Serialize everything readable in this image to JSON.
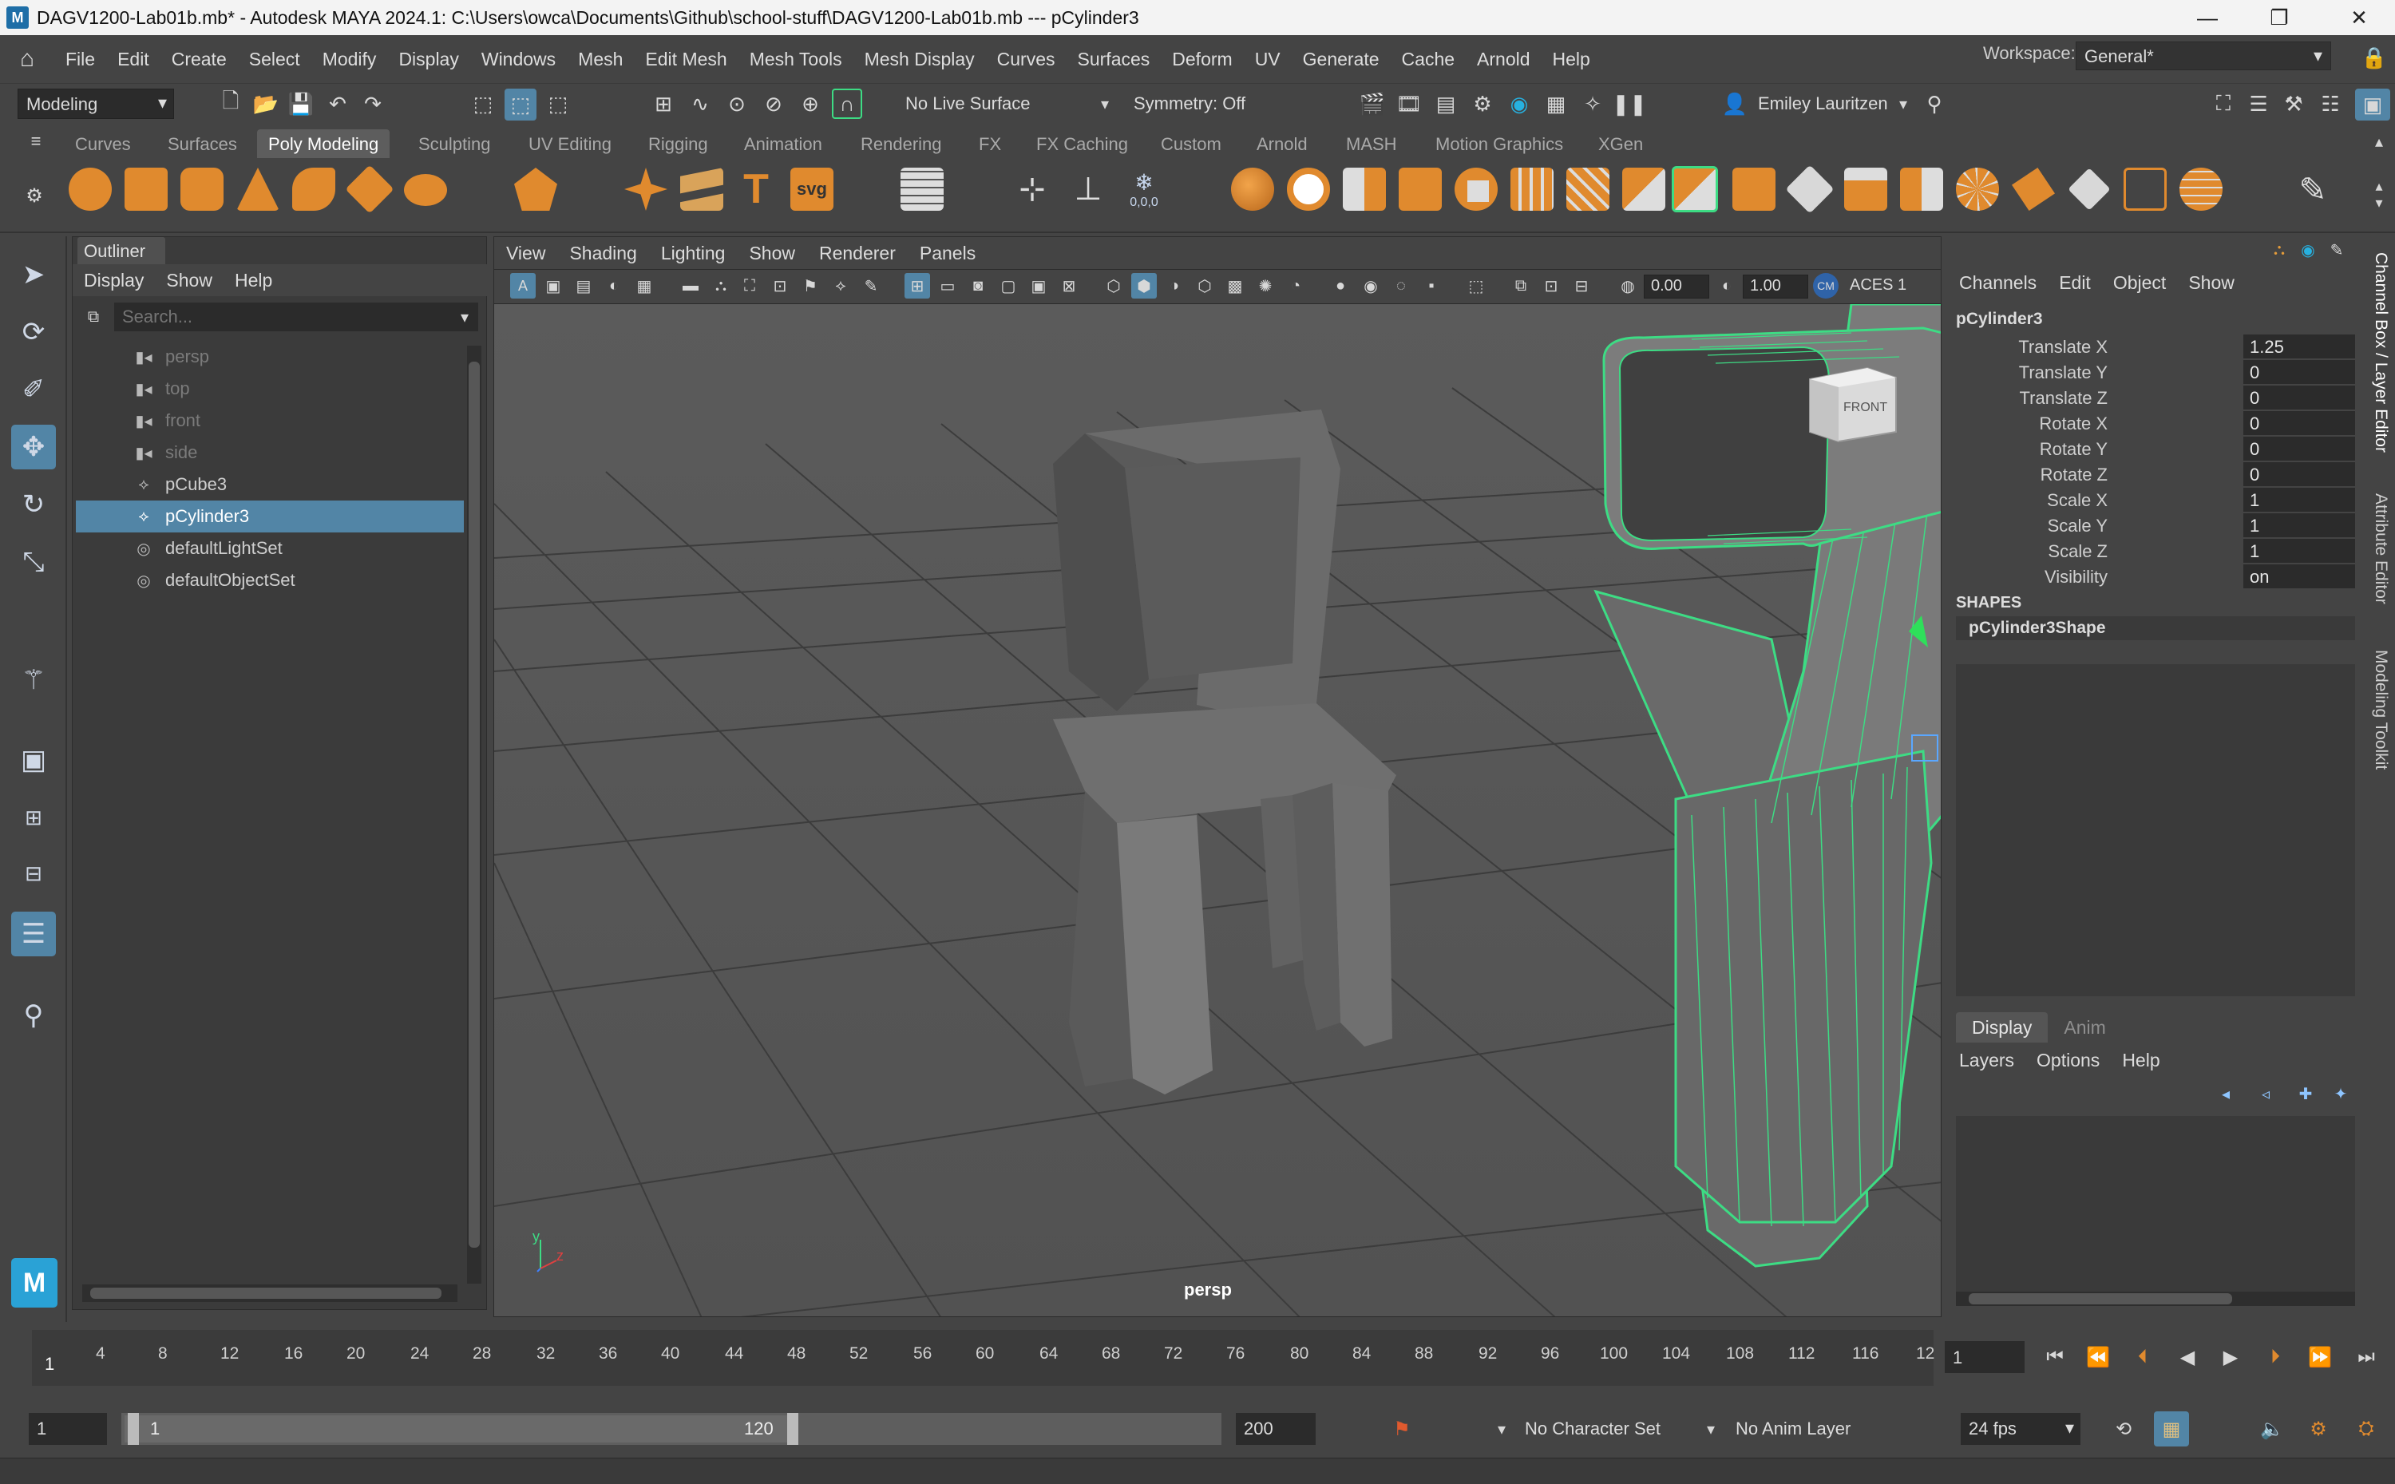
{
  "window": {
    "app_logo": "M",
    "title": "DAGV1200-Lab01b.mb* - Autodesk MAYA 2024.1: C:\\Users\\owca\\Documents\\Github\\school-stuff\\DAGV1200-Lab01b.mb   ---   pCylinder3",
    "minimize": "—",
    "restore": "❐",
    "close": "✕"
  },
  "menubar": {
    "items": [
      "File",
      "Edit",
      "Create",
      "Select",
      "Modify",
      "Display",
      "Windows",
      "Mesh",
      "Edit Mesh",
      "Mesh Tools",
      "Mesh Display",
      "Curves",
      "Surfaces",
      "Deform",
      "UV",
      "Generate",
      "Cache",
      "Arnold",
      "Help"
    ],
    "workspace_label": "Workspace:",
    "workspace_value": "General*"
  },
  "statusline": {
    "mode": "Modeling",
    "live_surface": "No Live Surface",
    "symmetry": "Symmetry: Off",
    "user": "Emiley Lauritzen"
  },
  "shelf_tabs": [
    "Curves",
    "Surfaces",
    "Poly Modeling",
    "Sculpting",
    "UV Editing",
    "Rigging",
    "Animation",
    "Rendering",
    "FX",
    "FX Caching",
    "Custom",
    "Arnold",
    "MASH",
    "Motion Graphics",
    "XGen"
  ],
  "shelf_active": "Poly Modeling",
  "shelf_text_icons": {
    "text": "T",
    "svg": "svg",
    "coords": "0,0,0"
  },
  "outliner": {
    "title": "Outliner",
    "menu": [
      "Display",
      "Show",
      "Help"
    ],
    "search_placeholder": "Search...",
    "items": [
      {
        "label": "persp",
        "icon": "camera-icon",
        "dim": true
      },
      {
        "label": "top",
        "icon": "camera-icon",
        "dim": true
      },
      {
        "label": "front",
        "icon": "camera-icon",
        "dim": true
      },
      {
        "label": "side",
        "icon": "camera-icon",
        "dim": true
      },
      {
        "label": "pCube3",
        "icon": "mesh-icon",
        "dim": false
      },
      {
        "label": "pCylinder3",
        "icon": "mesh-icon",
        "dim": false,
        "selected": true
      },
      {
        "label": "defaultLightSet",
        "icon": "set-icon",
        "dim": false
      },
      {
        "label": "defaultObjectSet",
        "icon": "set-icon",
        "dim": false
      }
    ]
  },
  "viewport": {
    "menu": [
      "View",
      "Shading",
      "Lighting",
      "Show",
      "Renderer",
      "Panels"
    ],
    "exposure": "0.00",
    "gamma": "1.00",
    "colorspace": "ACES 1",
    "camera": "persp",
    "viewcube_label": "FRONT",
    "axis_y": "y",
    "axis_z": "z"
  },
  "channelbox": {
    "menu": [
      "Channels",
      "Edit",
      "Object",
      "Show"
    ],
    "object": "pCylinder3",
    "attributes": [
      {
        "label": "Translate X",
        "value": "1.25"
      },
      {
        "label": "Translate Y",
        "value": "0"
      },
      {
        "label": "Translate Z",
        "value": "0"
      },
      {
        "label": "Rotate X",
        "value": "0"
      },
      {
        "label": "Rotate Y",
        "value": "0"
      },
      {
        "label": "Rotate Z",
        "value": "0"
      },
      {
        "label": "Scale X",
        "value": "1"
      },
      {
        "label": "Scale Y",
        "value": "1"
      },
      {
        "label": "Scale Z",
        "value": "1"
      },
      {
        "label": "Visibility",
        "value": "on"
      }
    ],
    "shapes_header": "SHAPES",
    "shape_name": "pCylinder3Shape"
  },
  "layer_editor": {
    "tabs": [
      "Display",
      "Anim"
    ],
    "active_tab": "Display",
    "menu": [
      "Layers",
      "Options",
      "Help"
    ]
  },
  "side_tabs": [
    "Channel Box / Layer Editor",
    "Attribute Editor",
    "Modeling Toolkit"
  ],
  "timeslider": {
    "ticks": [
      "4",
      "8",
      "12",
      "16",
      "20",
      "24",
      "28",
      "32",
      "36",
      "40",
      "44",
      "48",
      "52",
      "56",
      "60",
      "64",
      "68",
      "72",
      "76",
      "80",
      "84",
      "88",
      "92",
      "96",
      "100",
      "104",
      "108",
      "112",
      "116",
      "12"
    ],
    "current_marker": "1",
    "current_frame": "1"
  },
  "rangebar": {
    "start": "1",
    "range_start": "1",
    "range_end": "120",
    "end": "200",
    "character_set": "No Character Set",
    "anim_layer": "No Anim Layer",
    "fps": "24 fps"
  },
  "colors": {
    "accent_selected": "#5285a6",
    "wireframe": "#3ddc84",
    "shelf_orange": "#e08a2e"
  }
}
